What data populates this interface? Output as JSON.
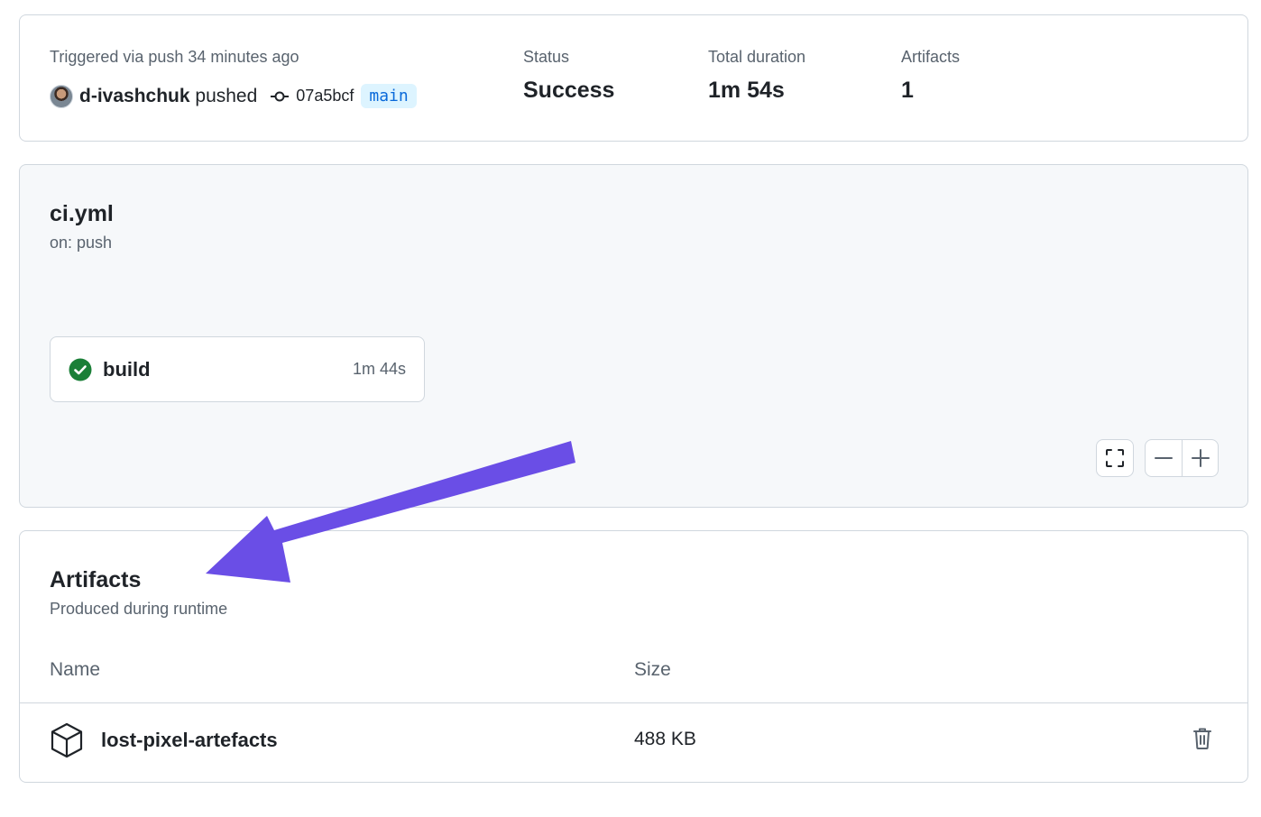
{
  "summary": {
    "trigger_label": "Triggered via push 34 minutes ago",
    "actor": "d-ivashchuk",
    "action": "pushed",
    "commit_sha": "07a5bcf",
    "branch": "main",
    "status_label": "Status",
    "status_value": "Success",
    "duration_label": "Total duration",
    "duration_value": "1m 54s",
    "artifacts_label": "Artifacts",
    "artifacts_value": "1"
  },
  "workflow": {
    "file": "ci.yml",
    "trigger": "on: push",
    "jobs": [
      {
        "name": "build",
        "duration": "1m 44s",
        "status": "success"
      }
    ],
    "controls": [
      "fit-to-screen-icon",
      "zoom-out-icon",
      "zoom-in-icon"
    ]
  },
  "artifacts": {
    "title": "Artifacts",
    "subtitle": "Produced during runtime",
    "columns": [
      "Name",
      "Size"
    ],
    "rows": [
      {
        "name": "lost-pixel-artefacts",
        "size": "488 KB",
        "icon": "package-icon"
      }
    ]
  },
  "annotation": {
    "type": "arrow",
    "color": "#6a4ee6"
  },
  "colors": {
    "success": "#1a7f37",
    "link": "#0969da",
    "branch_bg": "#ddf4ff",
    "border": "#d0d7de",
    "muted": "#59636e"
  }
}
